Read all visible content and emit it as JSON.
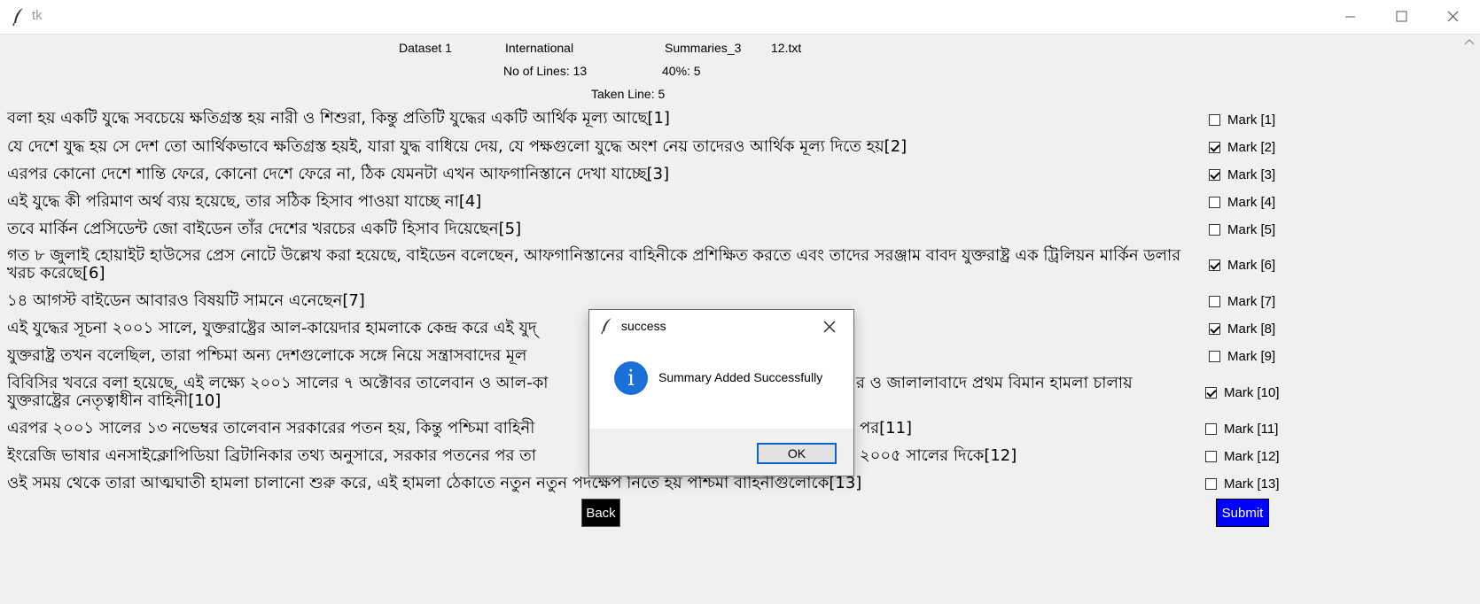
{
  "window": {
    "title": "tk"
  },
  "header": {
    "dataset": "Dataset 1",
    "category": "International",
    "summaries": "Summaries_3",
    "file": "12.txt",
    "lines": "No of Lines: 13",
    "percent": "40%: 5",
    "taken": "Taken Line: 5"
  },
  "rows": [
    {
      "text": "বলা হয় একটি যুদ্ধে সবচেয়ে ক্ষতিগ্রস্ত হয় নারী ও শিশুরা, কিন্তু প্রতিটি যুদ্ধের একটি আর্থিক মূল্য আছে[1]",
      "mark": "Mark [1]",
      "checked": false
    },
    {
      "text": "যে দেশে যুদ্ধ হয় সে দেশ তো আর্থিকভাবে ক্ষতিগ্রস্ত হয়ই, যারা যুদ্ধ বাধিয়ে দেয়, যে পক্ষগুলো যুদ্ধে অংশ নেয় তাদেরও আর্থিক মূল্য দিতে হয়[2]",
      "mark": "Mark [2]",
      "checked": true
    },
    {
      "text": "এরপর কোনো দেশে শান্তি ফেরে, কোনো দেশে ফেরে না, ঠিক যেমনটা এখন আফগানিস্তানে দেখা যাচ্ছে[3]",
      "mark": "Mark [3]",
      "checked": true
    },
    {
      "text": "এই যুদ্ধে কী পরিমাণ অর্থ ব্যয় হয়েছে, তার সঠিক হিসাব পাওয়া যাচ্ছে না[4]",
      "mark": "Mark [4]",
      "checked": false
    },
    {
      "text": "তবে মার্কিন প্রেসিডেন্ট জো বাইডেন তাঁর দেশের খরচের একটি হিসাব দিয়েছেন[5]",
      "mark": "Mark [5]",
      "checked": false
    },
    {
      "text": "গত ৮ জুলাই হোয়াইট হাউসের প্রেস নোটে উল্লেখ করা হয়েছে, বাইডেন বলেছেন, আফগানিস্তানের বাহিনীকে প্রশিক্ষিত করতে এবং তাদের সরঞ্জাম বাবদ যুক্তরাষ্ট্র এক ট্রিলিয়ন মার্কিন ডলার খরচ করেছে[6]",
      "mark": "Mark [6]",
      "checked": true
    },
    {
      "text": "১৪ আগস্ট বাইডেন আবারও বিষয়টি সামনে এনেছেন[7]",
      "mark": "Mark [7]",
      "checked": false
    },
    {
      "text": "এই যুদ্ধের সূচনা ২০০১ সালে, যুক্তরাষ্ট্রের আল-কায়েদার হামলাকে কেন্দ্র করে এই যুদ্",
      "mark": "Mark [8]",
      "checked": true
    },
    {
      "text": "যুক্তরাষ্ট্র তখন বলেছিল, তারা পশ্চিমা অন্য দেশগুলোকে সঙ্গে নিয়ে সন্ত্রাসবাদের মূল",
      "mark": "Mark [9]",
      "checked": false
    },
    {
      "text": "বিবিসির খবরে বলা হয়েছে, এই লক্ষ্যে ২০০১ সালের ৭ অক্টোবর তালেবান ও আল-কা",
      "text_right": "র ও জালালাবাদে প্রথম বিমান হামলা চালায়",
      "text2": "যুক্তরাষ্ট্রের নেতৃত্বাধীন বাহিনী[10]",
      "mark": "Mark [10]",
      "checked": true
    },
    {
      "text": "এরপর ২০০১ সালের ১৩ নভেম্বর তালেবান সরকারের পতন হয়, কিন্তু পশ্চিমা বাহিনী",
      "text_right": "পর[11]",
      "mark": "Mark [11]",
      "checked": false
    },
    {
      "text": "ইংরেজি ভাষার এনসাইক্লোপিডিয়া ব্রিটানিকার তথ্য অনুসারে, সরকার পতনের পর তা",
      "text_right": "২০০৫ সালের দিকে[12]",
      "mark": "Mark [12]",
      "checked": false
    },
    {
      "text": "ওই সময় থেকে তারা আত্মঘাতী হামলা চালানো শুরু করে, এই হামলা ঠেকাতে নতুন নতুন পদক্ষেপ নিতে হয় পশ্চিমা বাহিনীগুলোকে[13]",
      "mark": "Mark [13]",
      "checked": false
    }
  ],
  "buttons": {
    "back": "Back",
    "submit": "Submit"
  },
  "dialog": {
    "title": "success",
    "message": "Summary Added Successfully",
    "ok": "OK"
  },
  "colors": {
    "submit_bg": "#0000ff",
    "back_bg": "#000000",
    "info_icon": "#1a6fd8",
    "ok_border": "#0a64c8"
  }
}
